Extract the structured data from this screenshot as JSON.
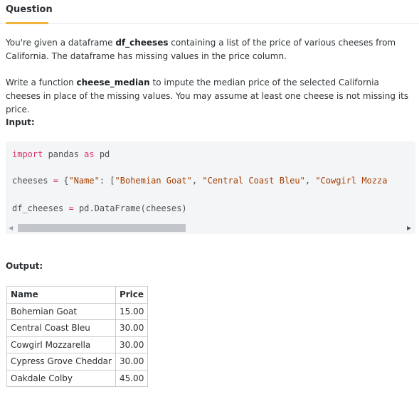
{
  "tab": {
    "label": "Question"
  },
  "description": {
    "p1_before": "You're given a dataframe ",
    "p1_bold": "df_cheeses",
    "p1_after": " containing a list of the price of various cheeses from California. The dataframe has missing values in the price column.",
    "p2_before": "Write a function ",
    "p2_bold": "cheese_median",
    "p2_after": " to impute the median price of the selected California cheeses in place of the missing values. You may assume at least one cheese is not missing its price."
  },
  "input_label": "Input:",
  "code": {
    "line1": {
      "keyword": "import",
      "rest1": " pandas ",
      "as": "as",
      "rest2": " pd"
    },
    "line2": {
      "var": "cheeses ",
      "eq": "=",
      "mid1": " {",
      "key": "\"Name\"",
      "mid2": ": [",
      "s1": "\"Bohemian Goat\"",
      "c1": ", ",
      "s2": "\"Central Coast Bleu\"",
      "c2": ", ",
      "s3": "\"Cowgirl Mozza"
    },
    "line3": {
      "var": "df_cheeses ",
      "eq": "=",
      "rest": " pd.DataFrame(cheeses)"
    }
  },
  "scrollbar": {
    "left_arrow": "◀",
    "right_arrow": "▶"
  },
  "output_label": "Output:",
  "table": {
    "headers": [
      "Name",
      "Price"
    ],
    "rows": [
      [
        "Bohemian Goat",
        "15.00"
      ],
      [
        "Central Coast Bleu",
        "30.00"
      ],
      [
        "Cowgirl Mozzarella",
        "30.00"
      ],
      [
        "Cypress Grove Cheddar",
        "30.00"
      ],
      [
        "Oakdale Colby",
        "45.00"
      ]
    ]
  }
}
